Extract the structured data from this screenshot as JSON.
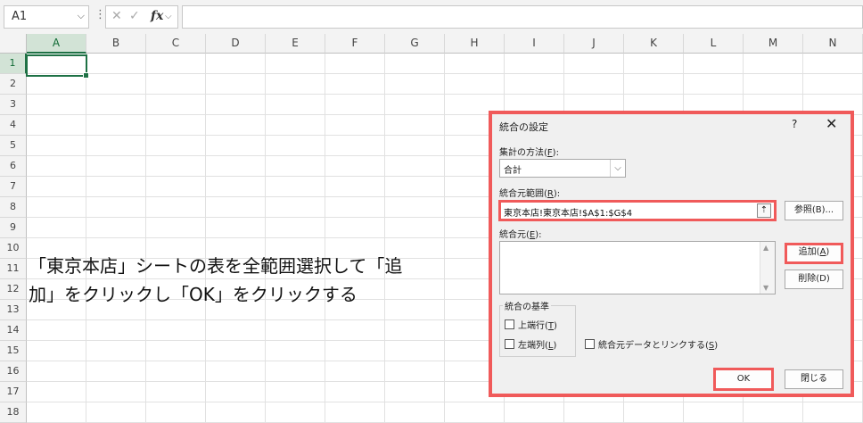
{
  "formula_bar": {
    "name_box": "A1",
    "name_box_icon": "chevron-down-icon",
    "more_icon": "vertical-dots-icon",
    "cancel_icon": "close-icon",
    "enter_icon": "check-icon",
    "fx_label": "fx",
    "formula": ""
  },
  "grid": {
    "columns": [
      "A",
      "B",
      "C",
      "D",
      "E",
      "F",
      "G",
      "H",
      "I",
      "J",
      "K",
      "L",
      "M",
      "N"
    ],
    "rows": [
      "1",
      "2",
      "3",
      "4",
      "5",
      "6",
      "7",
      "8",
      "9",
      "10",
      "11",
      "12",
      "13",
      "14",
      "15",
      "16",
      "17",
      "18"
    ],
    "active_cell": "A1",
    "accent_color": "#1e7145"
  },
  "instruction": {
    "line1": "「東京本店」シートの表を全範囲選択して「追",
    "line2": "加」をクリックし「OK」をクリックする"
  },
  "dialog": {
    "title": "統合の設定",
    "help": "?",
    "close": "✕",
    "function_label": "集計の方法(",
    "function_key": "F",
    "function_label_end": "):",
    "function_value": "合計",
    "reference_label": "統合元範囲(",
    "reference_key": "R",
    "reference_label_end": "):",
    "reference_value": "東京本店!東京本店!$A$1:$G$4",
    "browse_button": "参照(B)...",
    "all_refs_label": "統合元(",
    "all_refs_key": "E",
    "all_refs_label_end": "):",
    "add_button_text": "追加(",
    "add_button_key": "A",
    "add_button_end": ")",
    "delete_button": "削除(D)",
    "labels_group": "統合の基準",
    "top_row": "上端行(",
    "top_row_key": "T",
    "left_column": "左端列(",
    "left_column_key": "L",
    "link_source": "統合元データとリンクする(",
    "link_source_key": "S",
    "paren_close": ")",
    "ok_button": "OK",
    "close_button": "閉じる",
    "highlight_color": "#f05a5a"
  }
}
